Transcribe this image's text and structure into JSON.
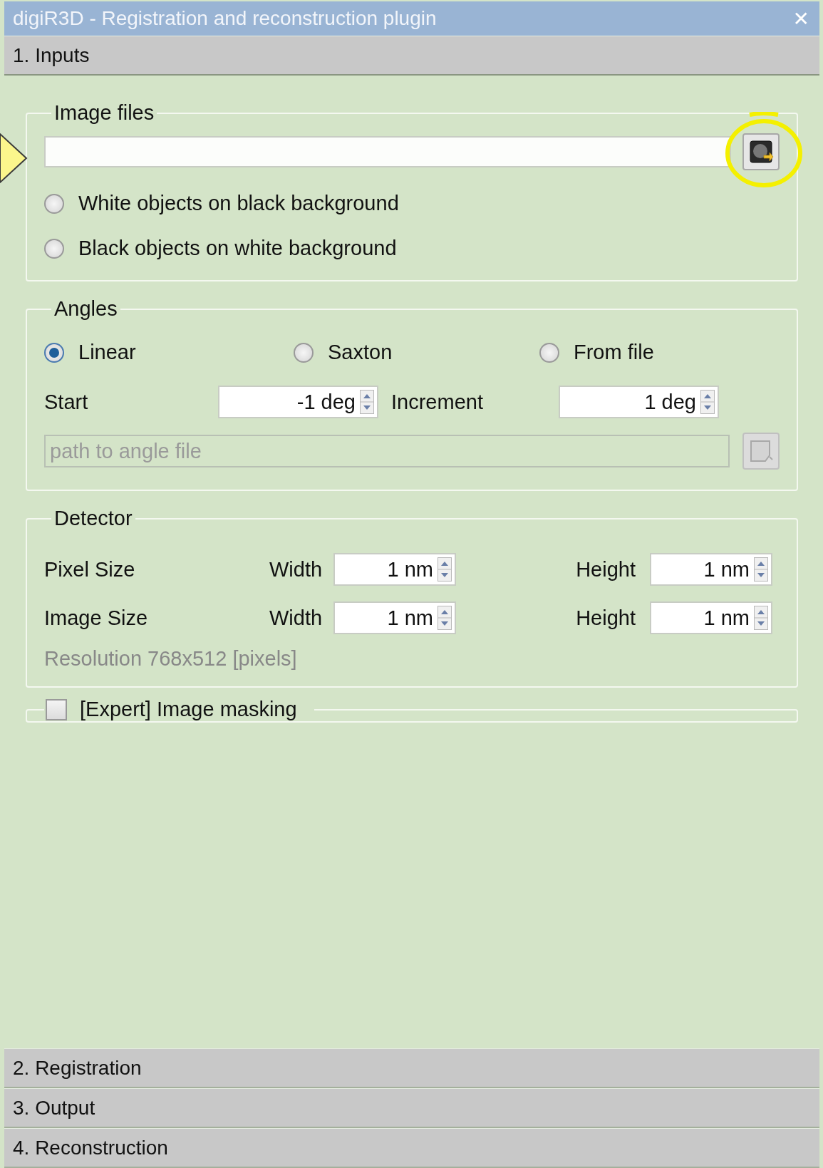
{
  "window": {
    "title": "digiR3D - Registration and reconstruction plugin",
    "close": "✕"
  },
  "sections": [
    {
      "label": "1. Inputs",
      "expanded": true
    },
    {
      "label": "2. Registration",
      "expanded": false
    },
    {
      "label": "3. Output",
      "expanded": false
    },
    {
      "label": "4. Reconstruction",
      "expanded": false
    }
  ],
  "image_files": {
    "title": "Image files",
    "options": [
      {
        "label": "White objects on black background",
        "selected": false
      },
      {
        "label": "Black objects on white background",
        "selected": false
      }
    ]
  },
  "angles": {
    "title": "Angles",
    "modes": [
      {
        "label": "Linear",
        "selected": true
      },
      {
        "label": "Saxton",
        "selected": false
      },
      {
        "label": "From file",
        "selected": false
      }
    ],
    "start": {
      "label": "Start",
      "value": "-1 deg"
    },
    "increment": {
      "label": "Increment",
      "value": "1 deg"
    },
    "file_field": {
      "placeholder": "path to angle file",
      "disabled": true
    }
  },
  "detector": {
    "title": "Detector",
    "rows": [
      {
        "label": "Pixel Size",
        "width_label": "Width",
        "width": "1 nm",
        "height_label": "Height",
        "height": "1 nm"
      },
      {
        "label": "Image Size",
        "width_label": "Width",
        "width": "1 nm",
        "height_label": "Height",
        "height": "1 nm"
      }
    ],
    "resolution": "Resolution 768x512 [pixels]"
  },
  "expert": {
    "label": "[Expert] Image masking",
    "checked": false
  }
}
